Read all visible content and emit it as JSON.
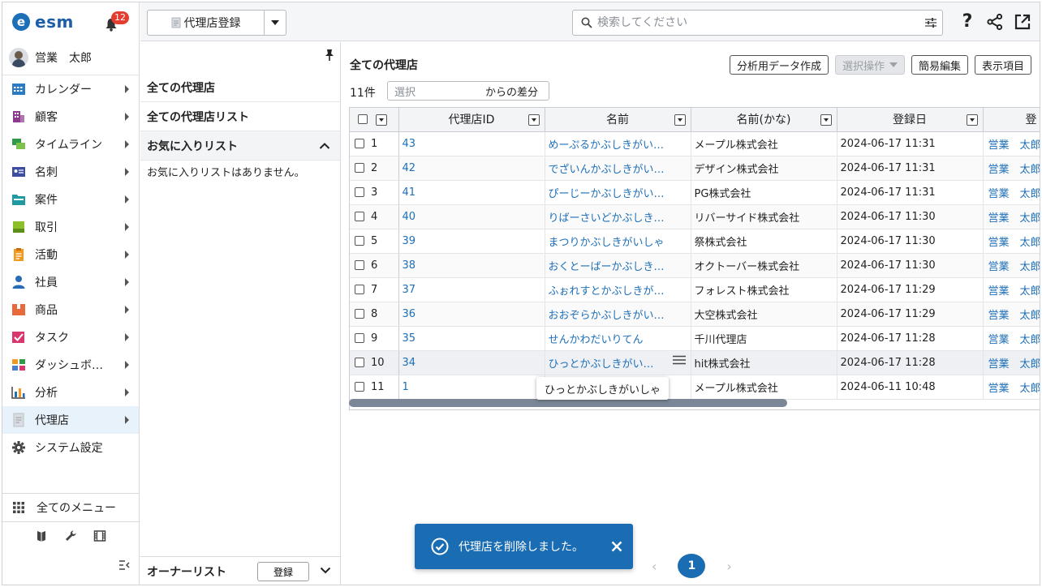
{
  "app": {
    "logo_text": "esm",
    "notification_count": "12"
  },
  "user": {
    "name": "営業　太郎"
  },
  "sidebar": {
    "items": [
      {
        "label": "カレンダー",
        "icon": "calendar-icon",
        "color": "#2a7bc4"
      },
      {
        "label": "顧客",
        "icon": "building-icon",
        "color": "#8e3a8f"
      },
      {
        "label": "タイムライン",
        "icon": "chat-icon",
        "color": "#2f9a4a"
      },
      {
        "label": "名刺",
        "icon": "business-card-icon",
        "color": "#3b4ea0"
      },
      {
        "label": "案件",
        "icon": "folder-icon",
        "color": "#1f9aa0"
      },
      {
        "label": "取引",
        "icon": "deal-icon",
        "color": "#8cbf2a"
      },
      {
        "label": "活動",
        "icon": "clipboard-icon",
        "color": "#f09a22"
      },
      {
        "label": "社員",
        "icon": "person-icon",
        "color": "#2a6bb6"
      },
      {
        "label": "商品",
        "icon": "box-icon",
        "color": "#e86a3b"
      },
      {
        "label": "タスク",
        "icon": "task-icon",
        "color": "#d8376e"
      },
      {
        "label": "ダッシュボ…",
        "icon": "dashboard-icon",
        "color": "#4a7fd0"
      },
      {
        "label": "分析",
        "icon": "chart-icon",
        "color": "#2a6bb6"
      },
      {
        "label": "代理店",
        "icon": "document-icon",
        "color": "#b9bec4"
      },
      {
        "label": "システム設定",
        "icon": "gear-icon",
        "color": "#444444"
      }
    ],
    "all_menu": "全てのメニュー"
  },
  "topbar": {
    "breadcrumb": "代理店登録",
    "search_placeholder": "検索してください"
  },
  "midpanel": {
    "rows": [
      "全ての代理店",
      "全ての代理店リスト",
      "お気に入りリスト"
    ],
    "fav_empty": "お気に入りリストはありません。",
    "owner_list": "オーナーリスト",
    "register": "登録"
  },
  "main": {
    "title": "全ての代理店",
    "actions": [
      "分析用データ作成",
      "選択操作",
      "簡易編集",
      "表示項目"
    ],
    "count": "11件",
    "diff_placeholder": "選択",
    "diff_suffix": "からの差分",
    "columns": [
      "代理店ID",
      "名前",
      "名前(かな)",
      "登録日",
      "登"
    ],
    "rows": [
      {
        "n": "1",
        "id": "43",
        "name": "めーぷるかぶしきがいしゃ",
        "kana": "メープル株式会社",
        "date": "2024-06-17 11:31",
        "owner": "営業　太郎"
      },
      {
        "n": "2",
        "id": "42",
        "name": "でざいんかぶしきがいしゃ",
        "kana": "デザイン株式会社",
        "date": "2024-06-17 11:31",
        "owner": "営業　太郎"
      },
      {
        "n": "3",
        "id": "41",
        "name": "ぴーじーかぶしきがいしゃ",
        "kana": "PG株式会社",
        "date": "2024-06-17 11:31",
        "owner": "営業　太郎"
      },
      {
        "n": "4",
        "id": "40",
        "name": "りばーさいどかぶしきがいしゃ",
        "kana": "リバーサイド株式会社",
        "date": "2024-06-17 11:30",
        "owner": "営業　太郎"
      },
      {
        "n": "5",
        "id": "39",
        "name": "まつりかぶしきがいしゃ",
        "kana": "祭株式会社",
        "date": "2024-06-17 11:30",
        "owner": "営業　太郎"
      },
      {
        "n": "6",
        "id": "38",
        "name": "おくとーばーかぶしきがいしゃ",
        "kana": "オクトーバー株式会社",
        "date": "2024-06-17 11:30",
        "owner": "営業　太郎"
      },
      {
        "n": "7",
        "id": "37",
        "name": "ふぉれすとかぶしきがいしゃ",
        "kana": "フォレスト株式会社",
        "date": "2024-06-17 11:29",
        "owner": "営業　太郎"
      },
      {
        "n": "8",
        "id": "36",
        "name": "おおぞらかぶしきがいしゃ",
        "kana": "大空株式会社",
        "date": "2024-06-17 11:29",
        "owner": "営業　太郎"
      },
      {
        "n": "9",
        "id": "35",
        "name": "せんかわだいりてん",
        "kana": "千川代理店",
        "date": "2024-06-17 11:28",
        "owner": "営業　太郎"
      },
      {
        "n": "10",
        "id": "34",
        "name": "ひっとかぶしきがいしゃ",
        "kana": "hit株式会社",
        "date": "2024-06-17 11:28",
        "owner": "営業　太郎"
      },
      {
        "n": "11",
        "id": "1",
        "name": "",
        "kana": "メープル株式会社",
        "date": "2024-06-11 10:48",
        "owner": "営業　太郎"
      }
    ],
    "tooltip": "ひっとかぶしきがいしゃ"
  },
  "toast": {
    "message": "代理店を削除しました。"
  },
  "pager": {
    "current": "1"
  }
}
